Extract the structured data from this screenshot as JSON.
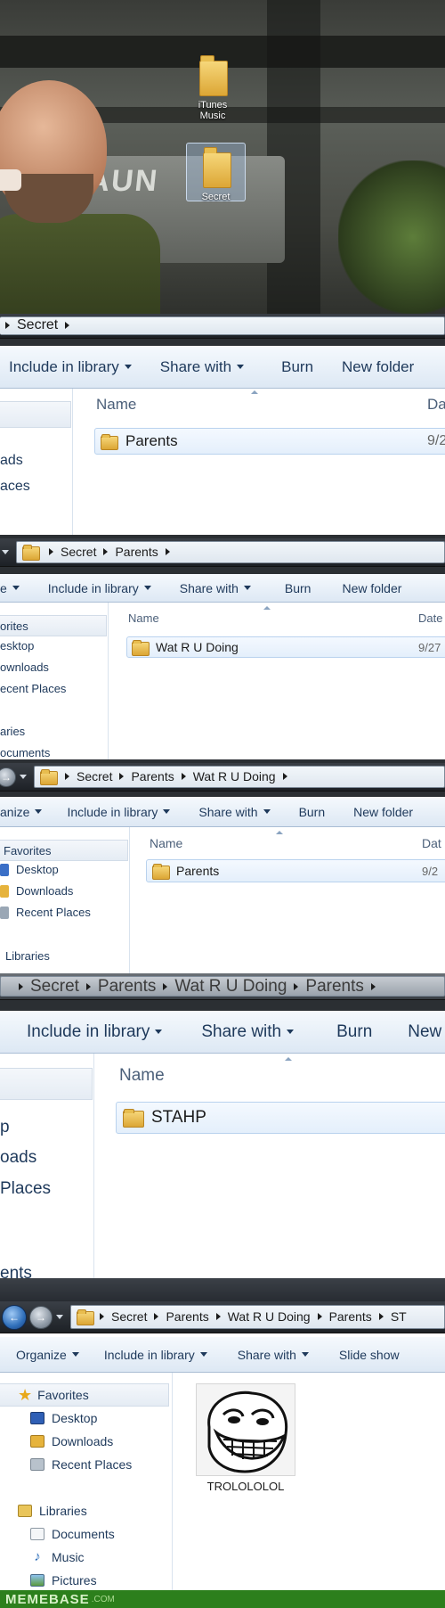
{
  "desktop": {
    "brand_text": "RAUN",
    "icons": [
      {
        "label": "iTunes Music"
      },
      {
        "label": "Secret"
      }
    ]
  },
  "panel1": {
    "breadcrumb": [
      "Secret"
    ],
    "toolbar": [
      "Include in library",
      "Share with",
      "Burn",
      "New folder"
    ],
    "nav": [
      "ads",
      "aces"
    ],
    "columns": {
      "name": "Name",
      "date": "Da"
    },
    "rows": [
      {
        "name": "Parents",
        "date": "9/2"
      }
    ]
  },
  "panel2": {
    "breadcrumb": [
      "Secret",
      "Parents"
    ],
    "toolbar": [
      "e",
      "Include in library",
      "Share with",
      "Burn",
      "New folder"
    ],
    "nav": [
      "orites",
      "esktop",
      "ownloads",
      "ecent Places",
      "aries",
      "ocuments"
    ],
    "columns": {
      "name": "Name",
      "date": "Date"
    },
    "rows": [
      {
        "name": "Wat R U Doing",
        "date": "9/27"
      }
    ]
  },
  "panel3": {
    "breadcrumb": [
      "Secret",
      "Parents",
      "Wat R U Doing"
    ],
    "toolbar": [
      "anize",
      "Include in library",
      "Share with",
      "Burn",
      "New folder"
    ],
    "nav": [
      "Favorites",
      "Desktop",
      "Downloads",
      "Recent Places",
      "Libraries"
    ],
    "columns": {
      "name": "Name",
      "date": "Dat"
    },
    "rows": [
      {
        "name": "Parents",
        "date": "9/2"
      }
    ]
  },
  "panel4": {
    "breadcrumb": [
      "Secret",
      "Parents",
      "Wat R U Doing",
      "Parents"
    ],
    "toolbar": [
      "Include in library",
      "Share with",
      "Burn",
      "New"
    ],
    "nav": [
      "p",
      "oads",
      "Places",
      "ents"
    ],
    "columns": {
      "name": "Name"
    },
    "rows": [
      {
        "name": "STAHP"
      }
    ]
  },
  "panel5": {
    "breadcrumb": [
      "Secret",
      "Parents",
      "Wat R U Doing",
      "Parents",
      "ST"
    ],
    "toolbar": [
      "Organize",
      "Include in library",
      "Share with",
      "Slide show"
    ],
    "nav": [
      "Favorites",
      "Desktop",
      "Downloads",
      "Recent Places",
      "Libraries",
      "Documents",
      "Music",
      "Pictures"
    ],
    "file": {
      "label": "TROLOLOLOL"
    }
  },
  "footer": {
    "brand": "MEMEBASE",
    "domain": ".COM"
  },
  "colors": {
    "brand_green": "#2c7f1c",
    "folder_yellow": "#f2c94c",
    "toolbar_text": "#1e395b"
  }
}
